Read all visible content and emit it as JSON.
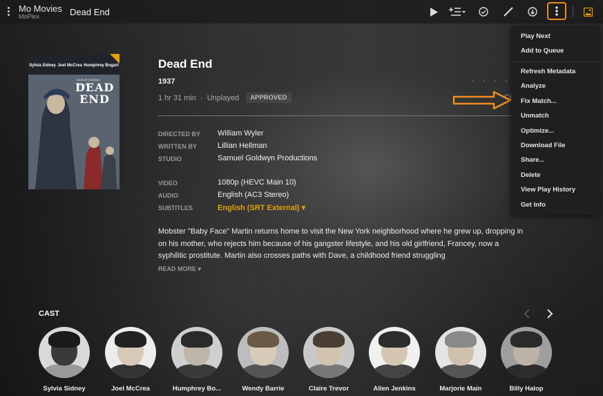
{
  "app": {
    "title": "Mo Movies",
    "subtitle": "MoPlex"
  },
  "breadcrumb": {
    "current": "Dead End"
  },
  "toolbar": {
    "icons": [
      "play-icon",
      "add-to-playlist-icon",
      "mark-played-icon",
      "edit-icon",
      "download-icon",
      "more-vert-icon",
      "artwork-icon"
    ],
    "highlight_color": "#f08a24"
  },
  "poster": {
    "names": [
      "Sylvia Sidney",
      "Joel McCrea",
      "Humphrey Bogart"
    ],
    "title": "DEAD END",
    "credit": "Samuel Goldwyn presents"
  },
  "movie": {
    "title": "Dead End",
    "year": "1937",
    "duration": "1 hr 31 min",
    "separator": "·",
    "status": "Unplayed",
    "rating": "APPROVED"
  },
  "details": {
    "directed_by_label": "DIRECTED BY",
    "directed_by": "William Wyler",
    "written_by_label": "WRITTEN BY",
    "written_by": "Lillian Hellman",
    "studio_label": "STUDIO",
    "studio": "Samuel Goldwyn Productions",
    "video_label": "VIDEO",
    "video": "1080p (HEVC Main 10)",
    "audio_label": "AUDIO",
    "audio": "English (AC3 Stereo)",
    "subtitles_label": "SUBTITLES",
    "subtitles": "English (SRT External) ▾"
  },
  "hidden_edge": {
    "dots": "· · · · ·",
    "cut_text": "Ci"
  },
  "description": "Mobster \"Baby Face\" Martin returns home to visit the New York neighborhood where he grew up, dropping in on his mother, who rejects him because of his gangster lifestyle, and his old girlfriend, Francey, now a syphilitic prostitute. Martin also crosses paths with Dave, a childhood friend struggling",
  "read_more": "READ MORE ▾",
  "cast": {
    "heading": "CAST",
    "members": [
      "Sylvia Sidney",
      "Joel McCrea",
      "Humphrey Bo...",
      "Wendy Barrie",
      "Claire Trevor",
      "Allen Jenkins",
      "Marjorie Main",
      "Billy Halop"
    ]
  },
  "menu": {
    "group1": [
      "Play Next",
      "Add to Queue"
    ],
    "group2": [
      "Refresh Metadata",
      "Analyze",
      "Fix Match...",
      "Unmatch",
      "Optimize...",
      "Download File",
      "Share...",
      "Delete",
      "View Play History",
      "Get Info"
    ]
  },
  "colors": {
    "accent": "#e5a00d",
    "annotation": "#f08a24"
  }
}
